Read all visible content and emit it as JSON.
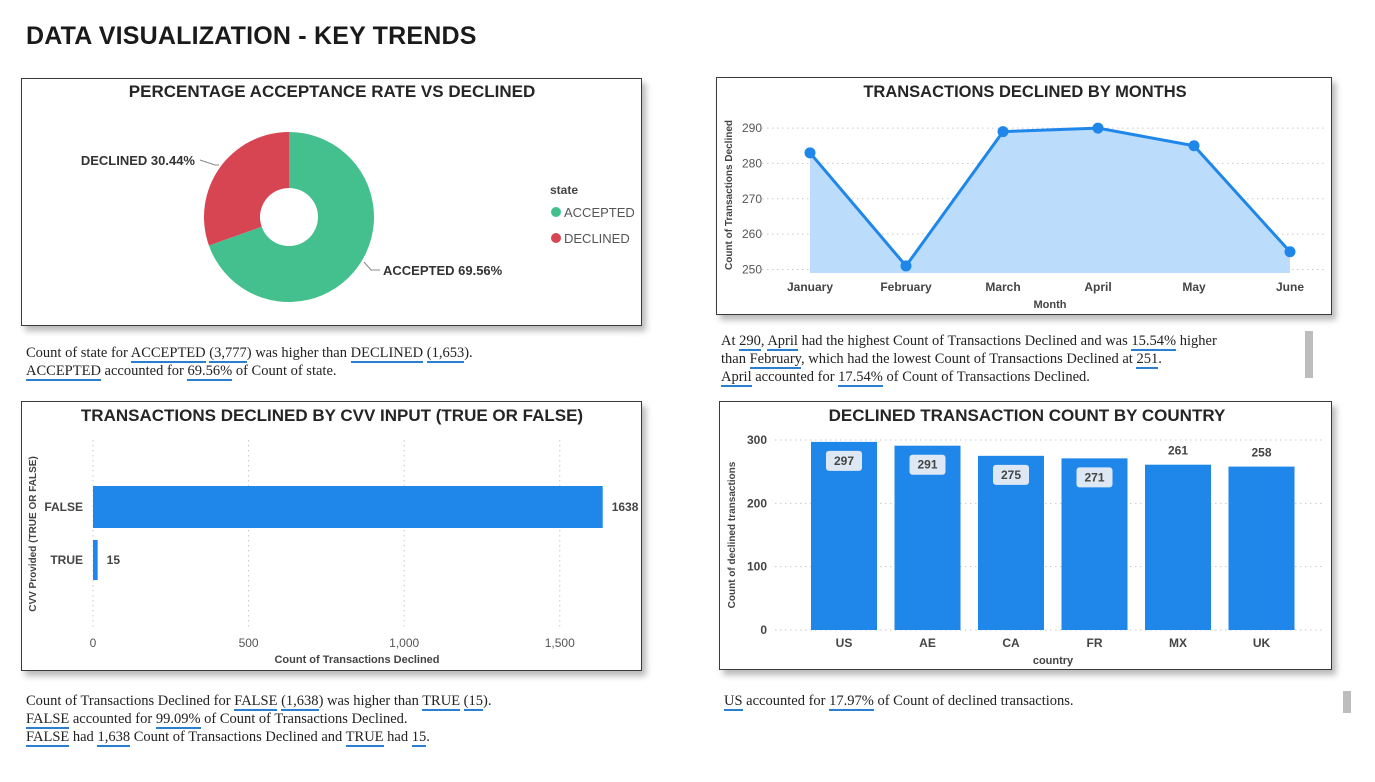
{
  "page": {
    "title": "DATA VISUALIZATION - KEY TRENDS"
  },
  "chart_data": [
    {
      "type": "pie",
      "variant": "donut",
      "title": "PERCENTAGE ACCEPTANCE RATE VS DECLINED",
      "legend_title": "state",
      "legend_position": "right",
      "slices": [
        {
          "label": "ACCEPTED",
          "value": 69.56,
          "count": 3777,
          "color": "#44c08f",
          "data_label": "ACCEPTED 69.56%"
        },
        {
          "label": "DECLINED",
          "value": 30.44,
          "count": 1653,
          "color": "#d84552",
          "data_label": "DECLINED 30.44%"
        }
      ]
    },
    {
      "type": "area",
      "title": "TRANSACTIONS DECLINED BY MONTHS",
      "xlabel": "Month",
      "ylabel": "Count of Transactions Declined",
      "categories": [
        "January",
        "February",
        "March",
        "April",
        "May",
        "June"
      ],
      "values": [
        283,
        251,
        289,
        290,
        285,
        255
      ],
      "ylim": [
        249,
        292
      ],
      "yticks": [
        250,
        260,
        270,
        280,
        290
      ],
      "grid": true,
      "line_color": "#1f86ea",
      "fill_color": "#bcdcfb"
    },
    {
      "type": "bar",
      "orientation": "horizontal",
      "title": "TRANSACTIONS DECLINED BY CVV INPUT (TRUE OR FALSE)",
      "xlabel": "Count of Transactions Declined",
      "ylabel": "CVV Provided (TRUE OR FALSE)",
      "categories": [
        "FALSE",
        "TRUE"
      ],
      "values": [
        1638,
        15
      ],
      "data_labels": [
        "1638",
        "15"
      ],
      "xlim": [
        0,
        1700
      ],
      "xticks": [
        0,
        500,
        1000,
        1500
      ],
      "xtick_labels": [
        "0",
        "500",
        "1,000",
        "1,500"
      ],
      "grid": true,
      "color": "#1f86ea"
    },
    {
      "type": "bar",
      "title": "DECLINED TRANSACTION COUNT BY COUNTRY",
      "xlabel": "country",
      "ylabel": "Count of declined transactions",
      "categories": [
        "US",
        "AE",
        "CA",
        "FR",
        "MX",
        "UK"
      ],
      "values": [
        297,
        291,
        275,
        271,
        261,
        258
      ],
      "data_labels": [
        "297",
        "291",
        "275",
        "271",
        "261",
        "258"
      ],
      "ylim": [
        0,
        300
      ],
      "yticks": [
        0,
        100,
        200,
        300
      ],
      "grid": true,
      "color": "#1f86ea"
    }
  ],
  "narratives": {
    "pie": [
      [
        "Count of state for ",
        {
          "u": "ACCEPTED"
        },
        " ",
        {
          "u": "(3,777"
        },
        ") was higher than ",
        {
          "u": "DECLINED"
        },
        " ",
        {
          "u": "(1,653"
        },
        ")."
      ],
      [
        {
          "u": "ACCEPTED"
        },
        " accounted for ",
        {
          "u": "69.56%"
        },
        " of Count of state."
      ]
    ],
    "months": [
      [
        "At ",
        {
          "u": "290"
        },
        ", ",
        {
          "u": "April"
        },
        " had the highest Count of Transactions Declined and was ",
        {
          "u": "15.54%"
        },
        " higher"
      ],
      [
        "than ",
        {
          "u": "February"
        },
        ", which had the lowest Count of Transactions Declined at ",
        {
          "u": "251"
        },
        "."
      ],
      [
        {
          "u": "April"
        },
        " accounted for ",
        {
          "u": "17.54%"
        },
        " of Count of Transactions Declined."
      ]
    ],
    "cvv": [
      [
        "Count of Transactions Declined for ",
        {
          "u": "FALSE"
        },
        " ",
        {
          "u": "(1,638"
        },
        ") was higher than ",
        {
          "u": "TRUE"
        },
        " ",
        {
          "u": "(15"
        },
        ")."
      ],
      [
        {
          "u": "FALSE"
        },
        " accounted for ",
        {
          "u": "99.09%"
        },
        " of Count of Transactions Declined."
      ],
      [
        {
          "u": "FALSE"
        },
        " had ",
        {
          "u": "1,638"
        },
        " Count of Transactions Declined and ",
        {
          "u": "TRUE"
        },
        " had ",
        {
          "u": "15"
        },
        "."
      ]
    ],
    "country": [
      [
        {
          "u": "US"
        },
        " accounted for ",
        {
          "u": "17.97%"
        },
        " of Count of declined transactions."
      ]
    ]
  }
}
